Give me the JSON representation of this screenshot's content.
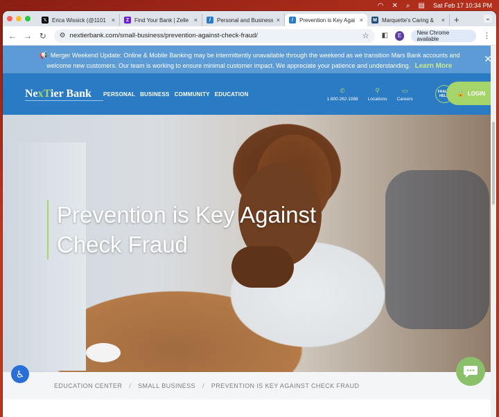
{
  "menubar": {
    "date_time": "Sat Feb 17  10:34 PM"
  },
  "browser": {
    "tabs": [
      {
        "title": "Erica Wissick (@1101",
        "favicon": "x-icon",
        "color": "#000000"
      },
      {
        "title": "Find Your Bank | Zelle",
        "favicon": "zelle-icon",
        "color": "#6d1ed4"
      },
      {
        "title": "Personal and Business",
        "favicon": "nextier-icon",
        "color": "#2a7ac4"
      },
      {
        "title": "Prevention is Key Agai",
        "favicon": "nextier-icon",
        "color": "#2a7ac4"
      },
      {
        "title": "Marquette's Caring & ",
        "favicon": "marquette-icon",
        "color": "#1e4e78"
      }
    ],
    "url": "nextierbank.com/small-business/prevention-against-check-fraud/",
    "update_button": "New Chrome available",
    "profile_initial": "E"
  },
  "alert": {
    "text": "Merger Weekend Update: Online & Mobile Banking may be intermittently unavailable through the weekend as we transition Mars Bank accounts and welcome new customers. Our team is working to ensure minimal customer impact. We appreciate your patience and understanding.",
    "link": "Learn More"
  },
  "header": {
    "logo_a": "Ne",
    "logo_x": "xT",
    "logo_b": "ier Bank",
    "nav": [
      "PERSONAL",
      "BUSINESS",
      "COMMUNITY",
      "EDUCATION"
    ],
    "phone": "1.800.262.1088",
    "locations": "Locations",
    "careers": "Careers",
    "fraud": "FRAUD HELP",
    "login": "LOGIN"
  },
  "hero": {
    "title": "Prevention is Key Against Check Fraud"
  },
  "breadcrumb": [
    "EDUCATION CENTER",
    "SMALL BUSINESS",
    "PREVENTION IS KEY AGAINST CHECK FRAUD"
  ],
  "colors": {
    "brand_blue": "#2a7ac4",
    "brand_green": "#a5d46b",
    "alert_blue": "#5d9bd6"
  }
}
